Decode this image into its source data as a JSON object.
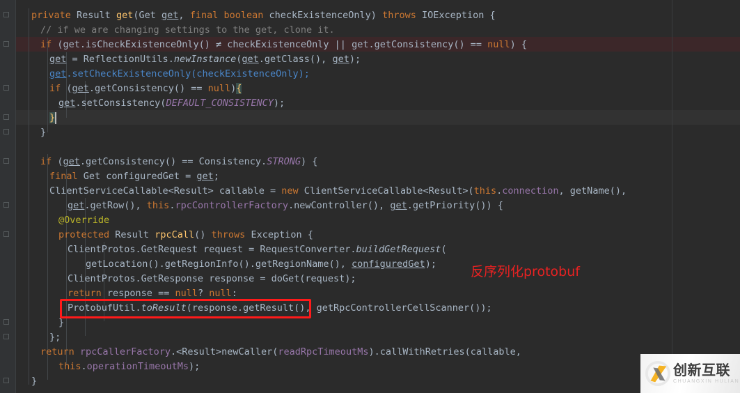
{
  "editor": {
    "language": "java",
    "theme": "darcula",
    "background_color": "#2b2b2b",
    "gutter_color": "#313335",
    "default_text_color": "#a9b7c6",
    "error_line_color": "#3c2729",
    "caret_line_color": "#323232"
  },
  "code_lines": [
    {
      "n": 1,
      "indent": 2,
      "text": "private Result get(Get get, final boolean checkExistenceOnly) throws IOException {"
    },
    {
      "n": 2,
      "indent": 4,
      "text": "// if we are changing settings to the get, clone it."
    },
    {
      "n": 3,
      "indent": 4,
      "text": "if (get.isCheckExistenceOnly() ≠ checkExistenceOnly || get.getConsistency() == null) {"
    },
    {
      "n": 4,
      "indent": 6,
      "text": "get = ReflectionUtils.newInstance(get.getClass(), get);"
    },
    {
      "n": 5,
      "indent": 6,
      "text": "get.setCheckExistenceOnly(checkExistenceOnly);"
    },
    {
      "n": 6,
      "indent": 6,
      "text": "if (get.getConsistency() == null){"
    },
    {
      "n": 7,
      "indent": 8,
      "text": "get.setConsistency(DEFAULT_CONSISTENCY);"
    },
    {
      "n": 8,
      "indent": 6,
      "text": "}"
    },
    {
      "n": 9,
      "indent": 4,
      "text": "}"
    },
    {
      "n": 10,
      "indent": 0,
      "text": ""
    },
    {
      "n": 11,
      "indent": 4,
      "text": "if (get.getConsistency() == Consistency.STRONG) {"
    },
    {
      "n": 12,
      "indent": 6,
      "text": "final Get configuredGet = get;"
    },
    {
      "n": 13,
      "indent": 6,
      "text": "ClientServiceCallable<Result> callable = new ClientServiceCallable<Result>(this.connection, getName(),"
    },
    {
      "n": 14,
      "indent": 8,
      "text": "get.getRow(), this.rpcControllerFactory.newController(), get.getPriority()) {"
    },
    {
      "n": 15,
      "indent": 8,
      "text": "@Override"
    },
    {
      "n": 16,
      "indent": 8,
      "text": "protected Result rpcCall() throws Exception {"
    },
    {
      "n": 17,
      "indent": 10,
      "text": "ClientProtos.GetRequest request = RequestConverter.buildGetRequest("
    },
    {
      "n": 18,
      "indent": 12,
      "text": "getLocation().getRegionInfo().getRegionName(), configuredGet);"
    },
    {
      "n": 19,
      "indent": 10,
      "text": "ClientProtos.GetResponse response = doGet(request);"
    },
    {
      "n": 20,
      "indent": 10,
      "text": "return response == null? null:"
    },
    {
      "n": 21,
      "indent": 10,
      "text": "ProtobufUtil.toResult(response.getResult(), getRpcControllerCellScanner());"
    },
    {
      "n": 22,
      "indent": 8,
      "text": "}"
    },
    {
      "n": 23,
      "indent": 6,
      "text": "};"
    },
    {
      "n": 24,
      "indent": 6,
      "text": "return rpcCallerFactory.<Result>newCaller(readRpcTimeoutMs).callWithRetries(callable,"
    },
    {
      "n": 25,
      "indent": 8,
      "text": "this.operationTimeoutMs);"
    },
    {
      "n": 26,
      "indent": 4,
      "text": "}"
    }
  ],
  "annotation": {
    "note_text": "反序列化protobuf",
    "note_color": "#e82222",
    "box_color": "#ff1a1a",
    "boxed_code": "ProtobufUtil.toResult(response.getResult(),"
  },
  "highlights": {
    "error_line": 3,
    "caret_line": 8,
    "caret_line_text": "}",
    "matched_braces": [
      "{",
      "}"
    ]
  },
  "watermark": {
    "brand_cn": "创新互联",
    "brand_en": "CHUANGXIN HULIAN",
    "logo_icon": "circle-x-logo-icon"
  }
}
